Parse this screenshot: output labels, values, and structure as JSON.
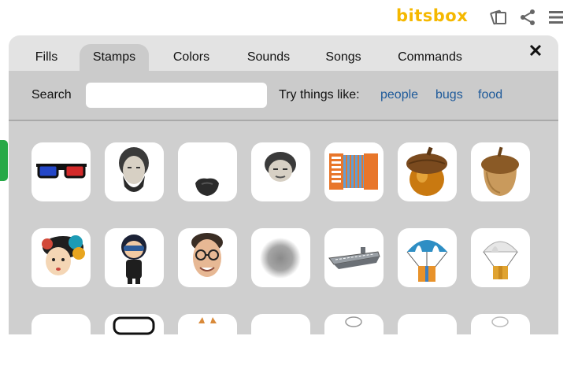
{
  "logo": "bitsbox",
  "top_icons": [
    "edit-cards-icon",
    "share-icon",
    "menu-icon"
  ],
  "tabs": [
    {
      "label": "Fills",
      "active": false
    },
    {
      "label": "Stamps",
      "active": true
    },
    {
      "label": "Colors",
      "active": false
    },
    {
      "label": "Sounds",
      "active": false
    },
    {
      "label": "Songs",
      "active": false
    },
    {
      "label": "Commands",
      "active": false
    }
  ],
  "search": {
    "label": "Search",
    "value": "",
    "placeholder": "",
    "try_label": "Try things like:",
    "suggestions": [
      "people",
      "bugs",
      "food"
    ]
  },
  "stamps": [
    "3d-glasses-icon",
    "lincoln-portrait-icon",
    "beard-icon",
    "lincoln-head-icon",
    "accordion-icon",
    "acorn-glossy-icon",
    "acorn-icon",
    "woman-flower-hair-icon",
    "pilot-boy-icon",
    "man-glasses-face-icon",
    "blur-circle-icon",
    "aircraft-carrier-icon",
    "parachute-gift-icon",
    "parachute-box-icon"
  ],
  "colors": {
    "logo": "#f5b800",
    "link": "#1e5a9a",
    "edge_tab": "#27a947",
    "panel": "#e3e3e3",
    "active_tab": "#cbcbcb"
  }
}
